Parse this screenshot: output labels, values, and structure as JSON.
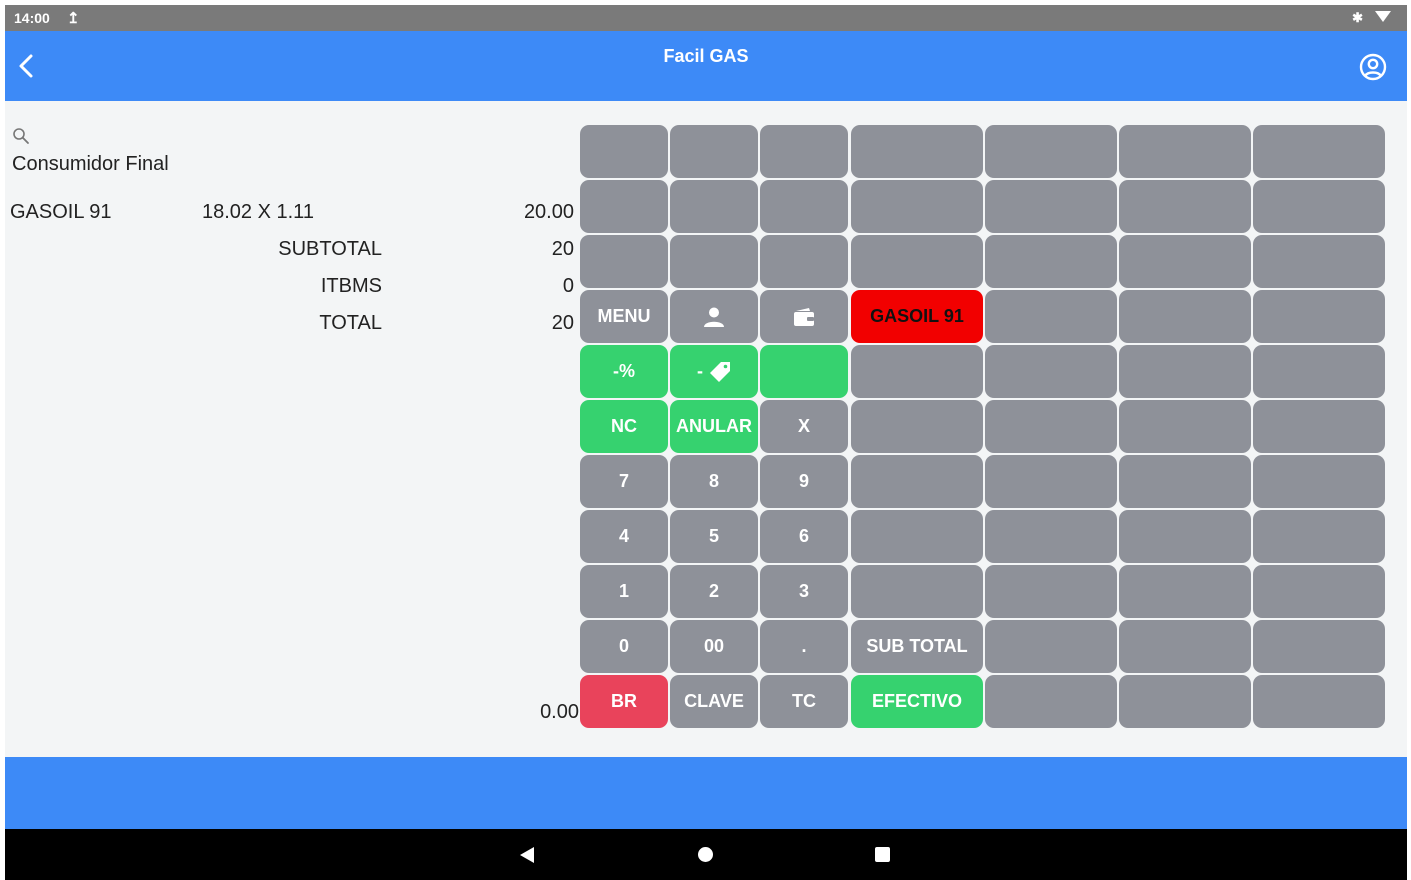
{
  "status_bar": {
    "time": "14:00"
  },
  "app_bar": {
    "title": "Facil GAS"
  },
  "customer": "Consumidor Final",
  "line_items": [
    {
      "description": "GASOIL 91",
      "quantity": "18.02 X 1.11",
      "amount": "20.00"
    }
  ],
  "summary": {
    "subtotal_label": "SUBTOTAL",
    "subtotal": "20",
    "tax_label": "ITBMS",
    "tax": "0",
    "total_label": "TOTAL",
    "total": "20"
  },
  "entry_amount": "0.00",
  "keys": {
    "menu": "MENU",
    "fuel_gasoil": "GASOIL 91",
    "discount_percent": "-%",
    "discount_tag_prefix": "-",
    "nc": "NC",
    "anular": "ANULAR",
    "times": "X",
    "k7": "7",
    "k8": "8",
    "k9": "9",
    "k4": "4",
    "k5": "5",
    "k6": "6",
    "k1": "1",
    "k2": "2",
    "k3": "3",
    "k0": "0",
    "k00": "00",
    "dot": ".",
    "sub_total": "SUB TOTAL",
    "br": "BR",
    "clave": "CLAVE",
    "tc": "TC",
    "efectivo": "EFECTIVO"
  },
  "colors": {
    "primary": "#3d8af7",
    "key_grey": "#8e9199",
    "key_green": "#36d26f",
    "key_red": "#f20000",
    "key_pink": "#e9435b"
  },
  "icons": [
    "back-arrow",
    "account-circle",
    "search",
    "person",
    "wallet",
    "price-tag",
    "upload",
    "bluetooth",
    "wifi"
  ]
}
